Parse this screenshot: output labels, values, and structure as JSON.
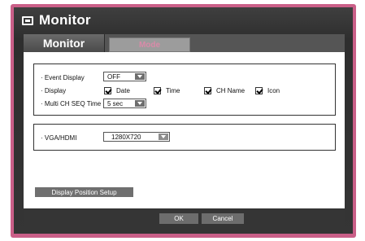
{
  "window": {
    "title": "Monitor",
    "title_icon": "monitor-icon"
  },
  "tabs": [
    {
      "label": "Monitor",
      "active": true
    },
    {
      "label": "Mode",
      "active": false
    }
  ],
  "settings": {
    "event_display": {
      "label": "· Event Display",
      "value": "OFF"
    },
    "display": {
      "label": "· Display",
      "options": [
        {
          "label": "Date",
          "checked": true
        },
        {
          "label": "Time",
          "checked": true
        },
        {
          "label": "CH Name",
          "checked": true
        },
        {
          "label": "Icon",
          "checked": true
        }
      ]
    },
    "multi_ch_seq_time": {
      "label": "· Multi CH SEQ Time",
      "value": "5 sec"
    },
    "vga_hdmi": {
      "label": "· VGA/HDMI",
      "value": "1280X720"
    }
  },
  "buttons": {
    "display_position_setup": "Display Position Setup",
    "ok": "OK",
    "cancel": "Cancel"
  },
  "colors": {
    "frame": "#ca5f88",
    "window_bg": "#333333",
    "tab_inactive_text": "#d98aa8"
  }
}
